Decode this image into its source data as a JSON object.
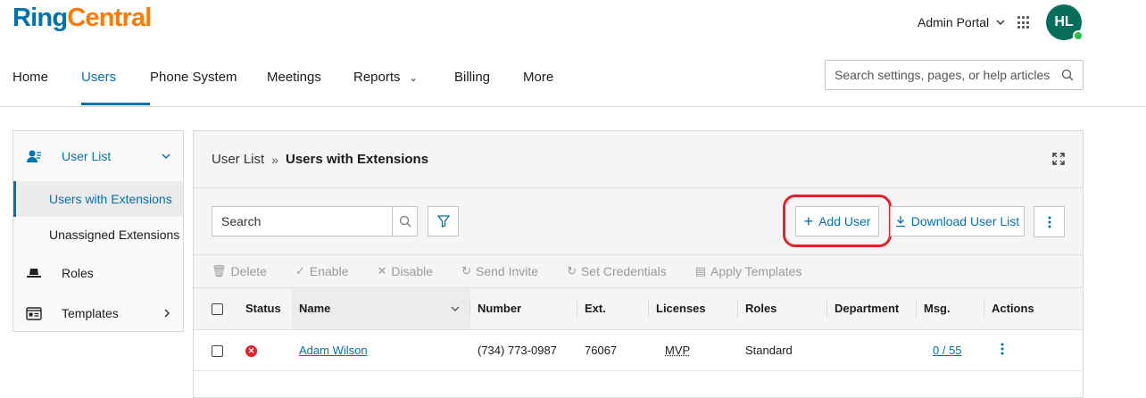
{
  "brand": {
    "part1": "Ring",
    "part2": "Central"
  },
  "header": {
    "admin_portal": "Admin Portal",
    "avatar_initials": "HL"
  },
  "nav": {
    "items": [
      {
        "label": "Home"
      },
      {
        "label": "Users"
      },
      {
        "label": "Phone System"
      },
      {
        "label": "Meetings"
      },
      {
        "label": "Reports"
      },
      {
        "label": "Billing"
      },
      {
        "label": "More"
      }
    ],
    "active": "Users"
  },
  "top_search": {
    "placeholder": "Search settings, pages, or help articles"
  },
  "sidebar": {
    "user_list": "User List",
    "users_with_extensions": "Users with Extensions",
    "unassigned_extensions": "Unassigned Extensions",
    "roles": "Roles",
    "templates": "Templates"
  },
  "breadcrumb": {
    "parent": "User List",
    "sep": "»",
    "current": "Users with Extensions"
  },
  "toolbar": {
    "search_placeholder": "Search",
    "add_user": "Add User",
    "download_user_list": "Download User List"
  },
  "bulk_actions": [
    "Delete",
    "Enable",
    "Disable",
    "Send Invite",
    "Set Credentials",
    "Apply Templates"
  ],
  "table": {
    "columns": [
      "Status",
      "Name",
      "Number",
      "Ext.",
      "Licenses",
      "Roles",
      "Department",
      "Msg.",
      "Actions"
    ],
    "rows": [
      {
        "status": "disabled",
        "name": "Adam Wilson",
        "number": "(734) 773-0987",
        "ext": "76067",
        "licenses": "MVP",
        "roles": "Standard",
        "department": "",
        "msg": "0 / 55"
      }
    ]
  },
  "colors": {
    "brand_blue": "#0073ae",
    "brand_orange": "#ff7a00",
    "avatar_green": "#066f5c",
    "highlight_red": "#e8202a"
  }
}
